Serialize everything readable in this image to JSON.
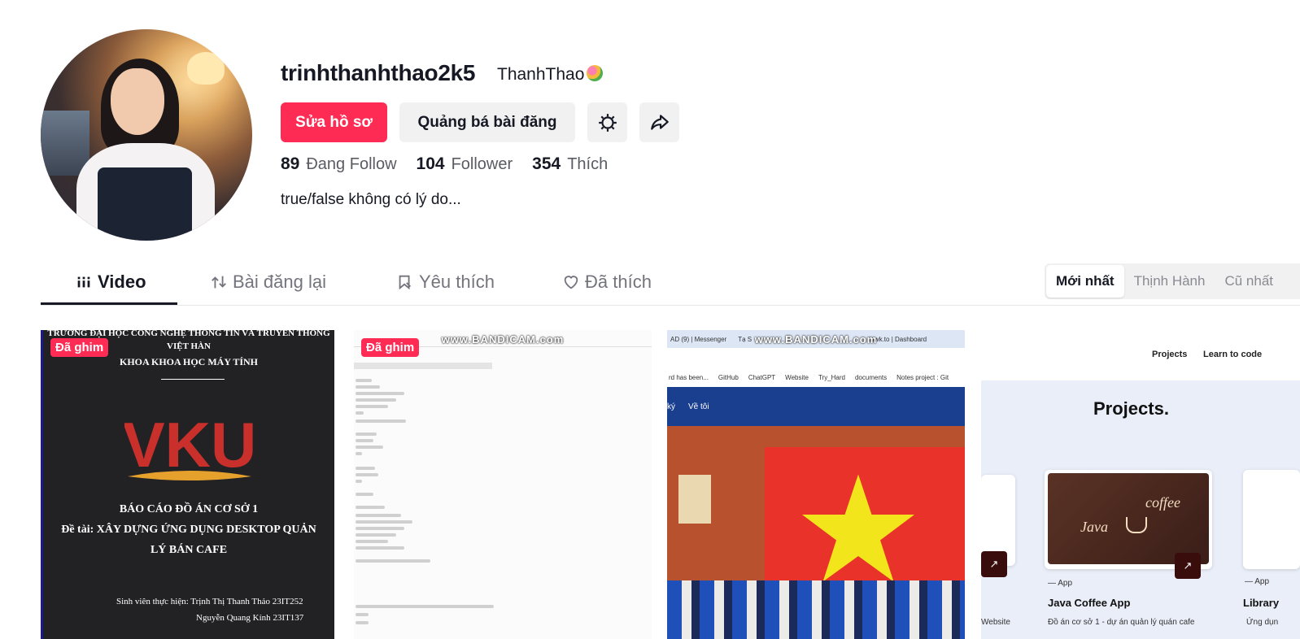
{
  "profile": {
    "username": "trinhthanhthao2k5",
    "nickname": "ThanhThao",
    "edit_button": "Sửa hồ sơ",
    "promote_button": "Quảng bá bài đăng",
    "stats": {
      "following_count": "89",
      "following_label": "Đang Follow",
      "followers_count": "104",
      "followers_label": "Follower",
      "likes_count": "354",
      "likes_label": "Thích"
    },
    "bio": "true/false không có lý do..."
  },
  "tabs": [
    {
      "label": "Video",
      "icon": "grid-icon",
      "active": true
    },
    {
      "label": "Bài đăng lại",
      "icon": "repost-icon",
      "active": false
    },
    {
      "label": "Yêu thích",
      "icon": "bookmark-icon",
      "active": false
    },
    {
      "label": "Đã thích",
      "icon": "heart-icon",
      "active": false
    }
  ],
  "sort": [
    "Mới nhất",
    "Thịnh Hành",
    "Cũ nhất"
  ],
  "videos": {
    "pinned_label": "Đã ghim",
    "v1": {
      "line1": "TRƯỜNG ĐẠI HỌC CÔNG NGHỆ THÔNG TIN VÀ TRUYỀN THÔNG",
      "line2": "VIỆT HÀN",
      "line3": "KHOA KHOA HỌC MÁY TÍNH",
      "logo_text": "VKU",
      "report_title": "BÁO CÁO ĐỒ ÁN CƠ SỞ 1",
      "topic_1": "Đề tài: XÂY DỰNG ỨNG DỤNG DESKTOP QUẢN",
      "topic_2": "LÝ BÁN CAFE",
      "student_1": "Sinh viên thực hiện: Trịnh Thị Thanh Thảo 23IT252",
      "student_2": "Nguyễn Quang Kính 23IT137"
    },
    "watermark": "www.BANDICAM.com",
    "v3": {
      "tabs": [
        "AD (9) | Messenger",
        "Tạ S",
        "tawk.to | Dashboard"
      ],
      "bookmarks": [
        "rd has been...",
        "GitHub",
        "ChatGPT",
        "Website",
        "Try_Hard",
        "documents",
        "Notes project : Git"
      ],
      "nav": [
        "ký",
        "Về tôi"
      ]
    },
    "v4": {
      "nav": [
        "Projects",
        "Learn to code"
      ],
      "title": "Projects.",
      "tag": "App",
      "card_title": "Java Coffee App",
      "card_desc": "Đồ án cơ sở 1 - dự án quản lý quán cafe",
      "left_caption": "Website",
      "right_title": "Library",
      "right_desc": "Ứng dụn",
      "img_java": "Java",
      "img_coffee": "coffee"
    }
  }
}
